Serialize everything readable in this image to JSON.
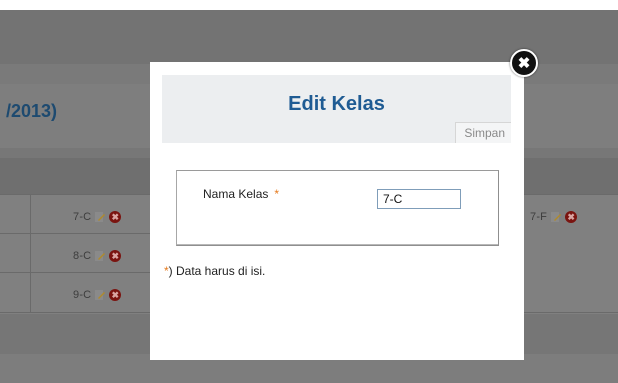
{
  "background": {
    "year_fragment": "/2013)",
    "cells": [
      {
        "label": "7-C"
      },
      {
        "label": "8-C"
      },
      {
        "label": "9-C"
      },
      {
        "label": "7-F"
      }
    ]
  },
  "modal": {
    "title": "Edit Kelas",
    "save_label": "Simpan",
    "field": {
      "label": "Nama Kelas",
      "required_mark": "*",
      "value": "7-C"
    },
    "note": {
      "star": "*",
      "text": ") Data harus di isi."
    },
    "close_symbol": "✖"
  },
  "icons": {
    "edit": "edit-pencil-icon",
    "delete": "delete-icon",
    "close": "close-icon"
  },
  "colors": {
    "title": "#1f5b93",
    "required": "#e57a1d",
    "delete_icon": "#7a1410",
    "close_button": "#111111"
  }
}
